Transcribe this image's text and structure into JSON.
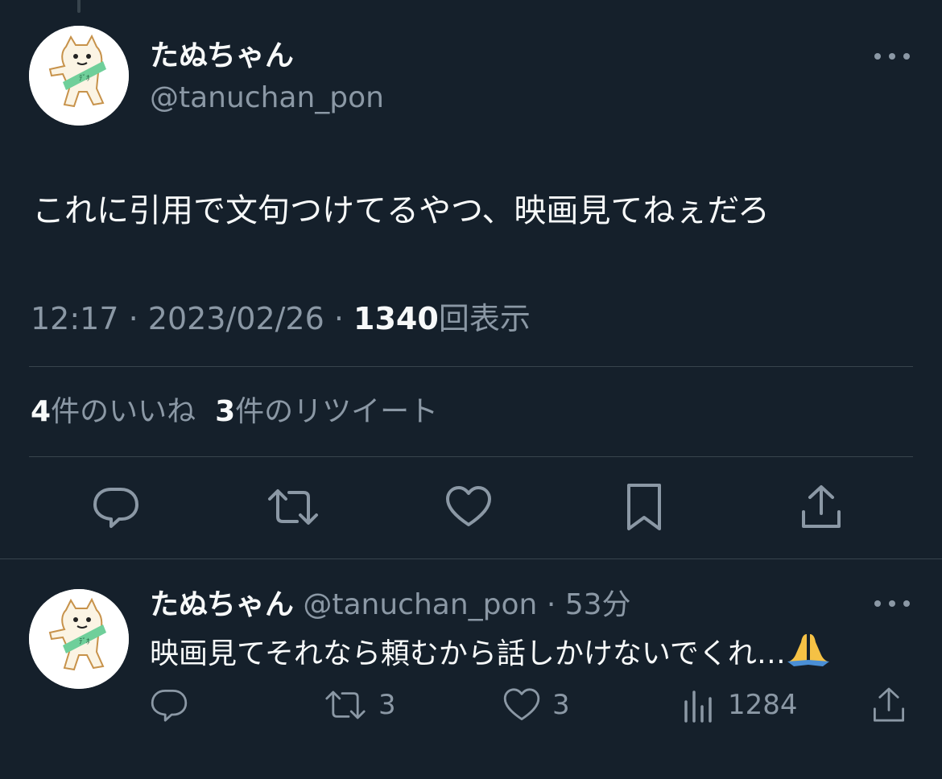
{
  "main_tweet": {
    "display_name": "たぬちゃん",
    "handle": "@tanuchan_pon",
    "text": "これに引用で文句つけてるやつ、映画見てねぇだろ",
    "time": "12:17",
    "sep1": " · ",
    "date": "2023/02/26",
    "sep2": " · ",
    "views_count": "1340",
    "views_label": "回表示",
    "likes_count": "4",
    "likes_label": "件のいいね",
    "retweets_count": "3",
    "retweets_label": "件のリツイート"
  },
  "reply": {
    "display_name": "たぬちゃん",
    "handle": "@tanuchan_pon",
    "separator": "·",
    "age": "53分",
    "text": "映画見てそれなら頼むから話しかけないでくれ…",
    "retweets": "3",
    "likes": "3",
    "views": "1284"
  },
  "icons": {
    "reply": "reply-icon",
    "retweet": "retweet-icon",
    "like": "heart-icon",
    "bookmark": "bookmark-icon",
    "share": "share-icon",
    "views": "analytics-icon",
    "more": "more-icon",
    "emoji": "folded-hands-emoji"
  },
  "colors": {
    "background": "#15202b",
    "text": "#f7f9f9",
    "secondary": "#8b98a5",
    "divider": "#38444d"
  }
}
